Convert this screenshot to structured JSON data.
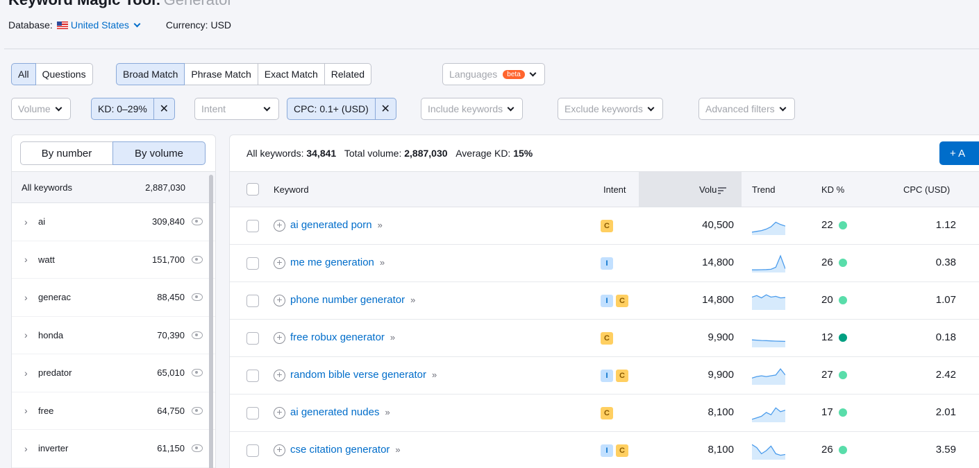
{
  "header": {
    "title": "Keyword Magic Tool:",
    "subtitle": "Generator",
    "database_label": "Database:",
    "database_value": "United States",
    "currency": "Currency: USD"
  },
  "match_tabs": [
    "All",
    "Questions",
    "Broad Match",
    "Phrase Match",
    "Exact Match",
    "Related"
  ],
  "languages": {
    "label": "Languages",
    "badge": "beta"
  },
  "filters": {
    "volume": "Volume",
    "kd_chip": "KD: 0–29%",
    "intent": "Intent",
    "cpc_chip": "CPC: 0.1+ (USD)",
    "include": "Include keywords",
    "exclude": "Exclude keywords",
    "advanced": "Advanced filters"
  },
  "sidebar": {
    "toggle": [
      "By number",
      "By volume"
    ],
    "header_label": "All keywords",
    "header_value": "2,887,030",
    "groups": [
      {
        "name": "ai",
        "value": "309,840"
      },
      {
        "name": "watt",
        "value": "151,700"
      },
      {
        "name": "generac",
        "value": "88,450"
      },
      {
        "name": "honda",
        "value": "70,390"
      },
      {
        "name": "predator",
        "value": "65,010"
      },
      {
        "name": "free",
        "value": "64,750"
      },
      {
        "name": "inverter",
        "value": "61,150"
      }
    ]
  },
  "summary": {
    "all_label": "All keywords:",
    "all_value": "34,841",
    "volume_label": "Total volume:",
    "volume_value": "2,887,030",
    "kd_label": "Average KD:",
    "kd_value": "15%"
  },
  "add_button": "+ A",
  "columns": {
    "keyword": "Keyword",
    "intent": "Intent",
    "volume": "Volu",
    "trend": "Trend",
    "kd": "KD %",
    "cpc": "CPC (USD)"
  },
  "colors": {
    "accent": "#006dca",
    "kd_easy": "#59ddaa",
    "kd_very_easy": "#009f81",
    "trend_line": "#4b9cec",
    "trend_fill": "#d6eafc"
  },
  "rows": [
    {
      "keyword": "ai generated porn",
      "intent": [
        "C"
      ],
      "volume": "40,500",
      "kd": "22",
      "kd_color": "#59ddaa",
      "cpc": "1.12",
      "trend": [
        0.1,
        0.15,
        0.2,
        0.3,
        0.45,
        0.75,
        0.6,
        0.5
      ]
    },
    {
      "keyword": "me me generation",
      "intent": [
        "I"
      ],
      "volume": "14,800",
      "kd": "26",
      "kd_color": "#59ddaa",
      "cpc": "0.38",
      "trend": [
        0.08,
        0.08,
        0.09,
        0.1,
        0.12,
        0.25,
        1.0,
        0.15
      ]
    },
    {
      "keyword": "phone number generator",
      "intent": [
        "I",
        "C"
      ],
      "volume": "14,800",
      "kd": "20",
      "kd_color": "#59ddaa",
      "cpc": "1.07",
      "trend": [
        0.75,
        0.85,
        0.7,
        0.9,
        0.75,
        0.8,
        0.7,
        0.72
      ]
    },
    {
      "keyword": "free robux generator",
      "intent": [
        "C"
      ],
      "volume": "9,900",
      "kd": "12",
      "kd_color": "#009f81",
      "cpc": "0.18",
      "trend": [
        0.4,
        0.38,
        0.36,
        0.35,
        0.33,
        0.32,
        0.31,
        0.3
      ]
    },
    {
      "keyword": "random bible verse generator",
      "intent": [
        "I",
        "C"
      ],
      "volume": "9,900",
      "kd": "27",
      "kd_color": "#59ddaa",
      "cpc": "2.42",
      "trend": [
        0.35,
        0.45,
        0.5,
        0.45,
        0.5,
        0.55,
        0.95,
        0.55
      ]
    },
    {
      "keyword": "ai generated nudes",
      "intent": [
        "C"
      ],
      "volume": "8,100",
      "kd": "17",
      "kd_color": "#59ddaa",
      "cpc": "2.01",
      "trend": [
        0.1,
        0.2,
        0.3,
        0.55,
        0.4,
        0.85,
        0.6,
        0.7
      ]
    },
    {
      "keyword": "cse citation generator",
      "intent": [
        "I",
        "C"
      ],
      "volume": "8,100",
      "kd": "26",
      "kd_color": "#59ddaa",
      "cpc": "3.59",
      "trend": [
        0.9,
        0.7,
        0.3,
        0.5,
        0.8,
        0.3,
        0.2,
        0.25
      ]
    }
  ]
}
